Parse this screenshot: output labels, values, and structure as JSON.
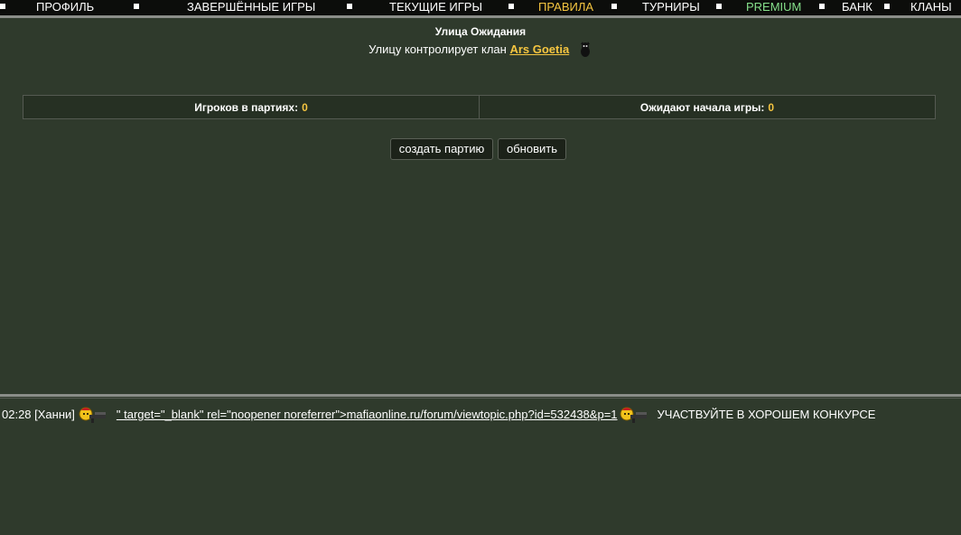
{
  "nav": {
    "items": [
      {
        "label": "ПРОФИЛЬ",
        "color": "#ffffff"
      },
      {
        "label": "ЗАВЕРШЁННЫЕ ИГРЫ",
        "color": "#ffffff"
      },
      {
        "label": "ТЕКУЩИЕ ИГРЫ",
        "color": "#ffffff"
      },
      {
        "label": "ПРАВИЛА",
        "color": "#f5c540"
      },
      {
        "label": "ТУРНИРЫ",
        "color": "#ffffff"
      },
      {
        "label": "PREMIUM",
        "color": "#86e08b"
      },
      {
        "label": "БАНК",
        "color": "#ffffff"
      },
      {
        "label": "КЛАНЫ",
        "color": "#ffffff"
      }
    ]
  },
  "street": {
    "title": "Улица Ожидания",
    "clan_prefix": "Улицу контролирует клан",
    "clan_name": "Ars Goetia"
  },
  "stats": {
    "players_label": "Игроков в партиях:",
    "players_value": "0",
    "waiting_label": "Ожидают начала игры:",
    "waiting_value": "0"
  },
  "buttons": {
    "create": "создать партию",
    "refresh": "обновить"
  },
  "chat": {
    "time_user": "02:28 [Ханни]",
    "link_text": "\" target=\"_blank\" rel=\"noopener noreferrer\">mafiaonline.ru/forum/viewtopic.php?id=532438&p=1",
    "message": "УЧАСТВУЙТЕ В ХОРОШЕМ КОНКУРСЕ"
  },
  "colors": {
    "background": "#2f3a2c",
    "nav_background": "#0c0d0b",
    "accent": "#f5c540",
    "premium": "#86e08b"
  }
}
